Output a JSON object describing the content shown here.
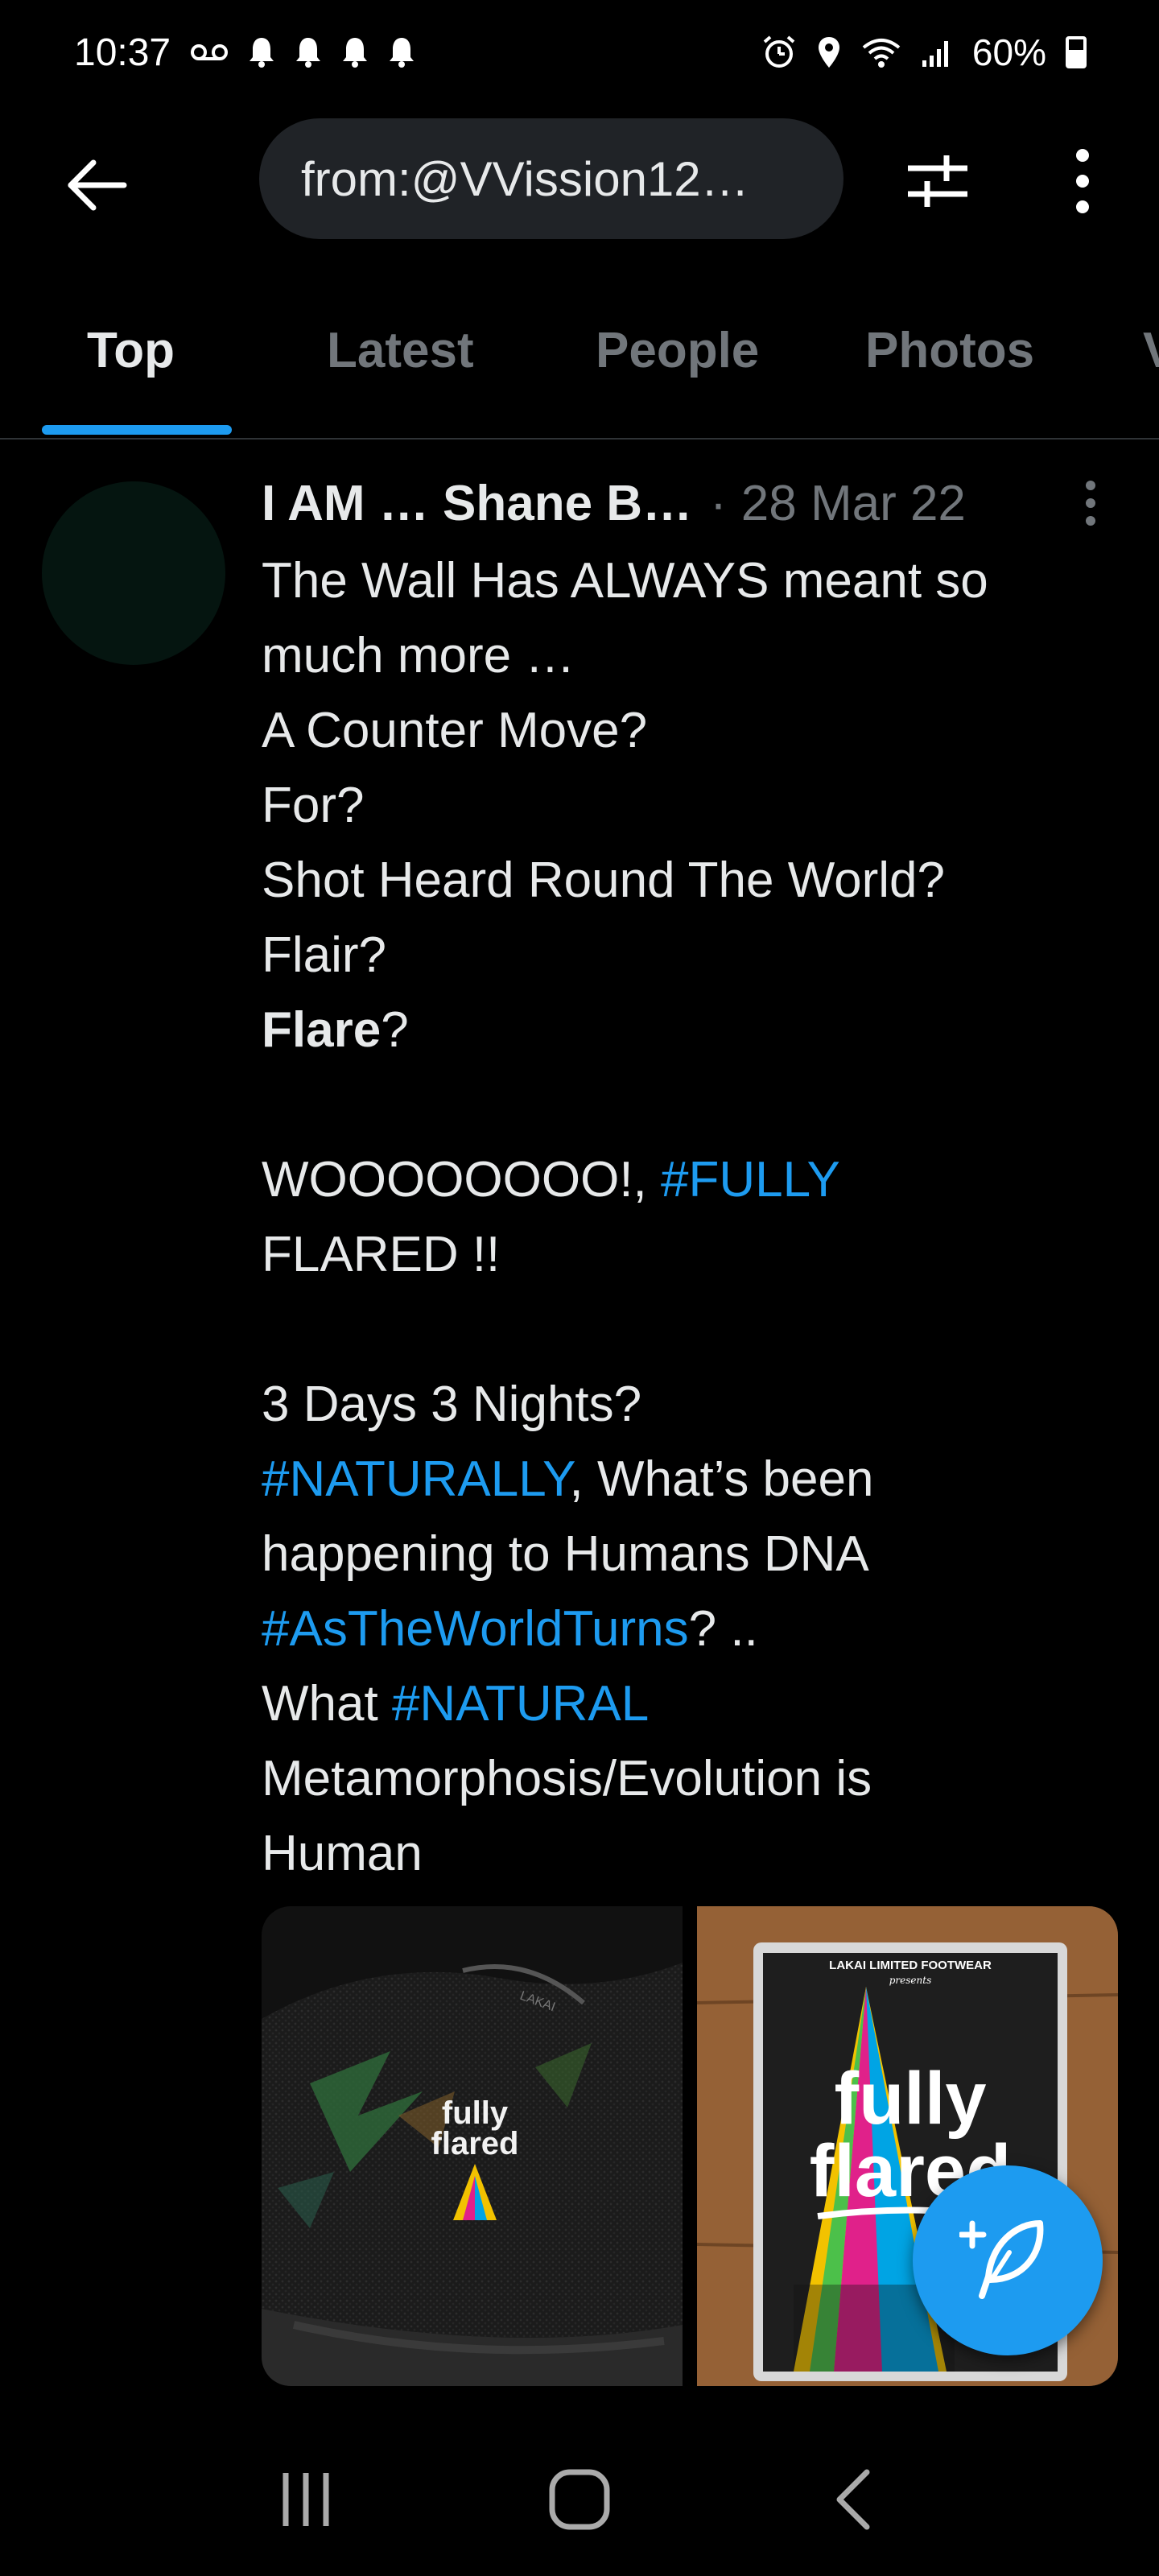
{
  "status_bar": {
    "time": "10:37",
    "battery": "60%"
  },
  "search": {
    "query": "from:@VVission12…"
  },
  "tabs": [
    {
      "label": "Top",
      "active": true
    },
    {
      "label": "Latest",
      "active": false
    },
    {
      "label": "People",
      "active": false
    },
    {
      "label": "Photos",
      "active": false
    },
    {
      "label": "V",
      "active": false
    }
  ],
  "tweet": {
    "author": "I AM … Shane B…",
    "separator": "·",
    "date": "28 Mar 22",
    "lines": {
      "l1": "The Wall Has ALWAYS meant so",
      "l2": "much more …",
      "l3": "A Counter Move?",
      "l4": "For?",
      "l5": "Shot Heard Round The World?",
      "l6": "Flair?",
      "l7_bold": "Flare",
      "l7_rest": "?",
      "l8_pre": "WOOOOOOOO!, ",
      "l8_tag": "#FULLY",
      "l9": "FLARED !!",
      "l10": "3 Days 3 Nights?",
      "l11_tag": "#NATURALLY",
      "l11_rest": ", What’s been",
      "l12": "happening to Humans DNA",
      "l13_tag": "#AsTheWorldTurns",
      "l13_rest": "? ..",
      "l14_pre": "What ",
      "l14_tag": "#NATURAL",
      "l15": "Metamorphosis/Evolution is",
      "l16": "Human"
    },
    "media": {
      "left_image": {
        "logo_line1": "fully",
        "logo_line2": "flared",
        "brand": "LAKAI"
      },
      "right_image": {
        "header": "LAKAI LIMITED FOOTWEAR",
        "presents": "presents",
        "logo_line1": "fully",
        "logo_line2": "flared"
      }
    }
  },
  "colors": {
    "accent": "#1d9bf0",
    "background": "#000000",
    "text": "#e7e9ea",
    "muted": "#71767b",
    "pill": "#202327"
  },
  "icons": {
    "back": "arrow-left-icon",
    "filter": "sliders-icon",
    "more": "more-vertical-icon",
    "compose": "compose-tweet-icon",
    "nav_recent": "recent-apps-icon",
    "nav_home": "home-icon",
    "nav_back": "back-chevron-icon"
  }
}
